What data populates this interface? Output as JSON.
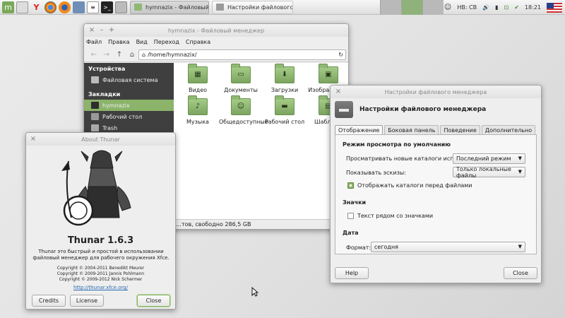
{
  "panel": {
    "tasks": [
      {
        "label": "hymnazix - Файловый мене…",
        "active": true
      },
      {
        "label": "Настройки файлового мене…",
        "active": false
      }
    ],
    "keyboard_layout": "НВ: СВ",
    "clock": "18:21"
  },
  "file_manager": {
    "title": "hymnazix - Файловый менеджер",
    "menu": [
      "Файл",
      "Правка",
      "Вид",
      "Переход",
      "Справка"
    ],
    "path": "/home/hymnazix/",
    "sidebar": {
      "devices_header": "Устройства",
      "devices": [
        "Файловая система"
      ],
      "bookmarks_header": "Закладки",
      "bookmarks": [
        "hymnazix",
        "Рабочий стол",
        "Trash"
      ]
    },
    "files": [
      "Видео",
      "Документы",
      "Загрузки",
      "Изображения",
      "Музыка",
      "Общедоступные",
      "Рабочий стол",
      "Шаблоны"
    ],
    "status_text": "…тов, свободно 286,5 GB"
  },
  "about": {
    "title": "About Thunar",
    "app_name": "Thunar 1.6.3",
    "description": "Thunar это быстрый и простой в использовании файловый менеджер для рабочего окружения Xfce.",
    "copyrights": [
      "Copyright © 2004-2011 Benedikt Meurer",
      "Copyright © 2009-2011 Jannis Pohlmann",
      "Copyright © 2009-2012 Nick Schermer"
    ],
    "link": "http://thunar.xfce.org/",
    "buttons": {
      "credits": "Credits",
      "license": "License",
      "close": "Close"
    }
  },
  "prefs": {
    "title": "Настройки файлового менеджера",
    "header": "Настройки файлового менеджера",
    "tabs": [
      "Отображение",
      "Боковая панель",
      "Поведение",
      "Дополнительно"
    ],
    "view_section": "Режим просмотра по умолчанию",
    "browse_label": "Просматривать новые каталоги используя:",
    "browse_value": "Последний режим",
    "thumbs_label": "Показывать эскизы:",
    "thumbs_value": "Только локальные файлы",
    "folders_first": "Отображать каталоги перед файлами",
    "icons_section": "Значки",
    "text_beside": "Текст рядом со значками",
    "date_section": "Дата",
    "format_label": "Формат:",
    "format_value": "сегодня",
    "help": "Help",
    "close": "Close"
  },
  "colors": {
    "accent": "#8bb46a",
    "sidebar_bg": "#3f3f3f",
    "folder": "#8fb874"
  }
}
